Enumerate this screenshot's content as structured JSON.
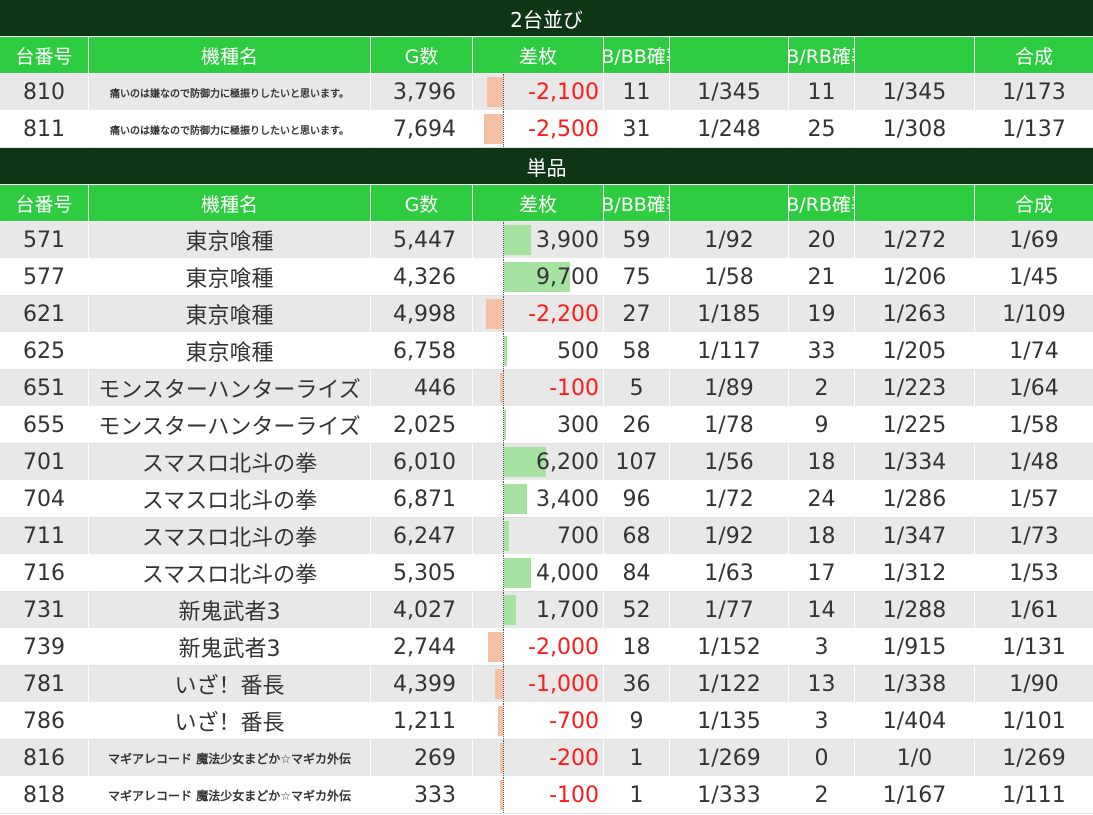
{
  "colors": {
    "header_bg": "#2ecc40",
    "section_bg": "#0e3614",
    "positive_bar": "#a6e3a0",
    "negative_bar": "#f4bfa2",
    "negative_text": "#ff1a1a"
  },
  "columns": [
    "台番号",
    "機種名",
    "G数",
    "差枚",
    "BB/BB確率",
    "",
    "RB/RB確率",
    "",
    "合成"
  ],
  "sections": [
    {
      "title": "2台並び",
      "rows": [
        {
          "no": "810",
          "name": "痛いのは嫌なので防御力に極振りしたいと思います。",
          "size": "small",
          "games": "3,796",
          "diff": "-2,100",
          "diff_value": -2100,
          "bb": "11",
          "bb_rate": "1/345",
          "rb": "11",
          "rb_rate": "1/345",
          "total": "1/173"
        },
        {
          "no": "811",
          "name": "痛いのは嫌なので防御力に極振りしたいと思います。",
          "size": "small",
          "games": "7,694",
          "diff": "-2,500",
          "diff_value": -2500,
          "bb": "31",
          "bb_rate": "1/248",
          "rb": "25",
          "rb_rate": "1/308",
          "total": "1/137"
        }
      ]
    },
    {
      "title": "単品",
      "rows": [
        {
          "no": "571",
          "name": "東京喰種",
          "size": "normal",
          "games": "5,447",
          "diff": "3,900",
          "diff_value": 3900,
          "bb": "59",
          "bb_rate": "1/92",
          "rb": "20",
          "rb_rate": "1/272",
          "total": "1/69"
        },
        {
          "no": "577",
          "name": "東京喰種",
          "size": "normal",
          "games": "4,326",
          "diff": "9,700",
          "diff_value": 9700,
          "bb": "75",
          "bb_rate": "1/58",
          "rb": "21",
          "rb_rate": "1/206",
          "total": "1/45"
        },
        {
          "no": "621",
          "name": "東京喰種",
          "size": "normal",
          "games": "4,998",
          "diff": "-2,200",
          "diff_value": -2200,
          "bb": "27",
          "bb_rate": "1/185",
          "rb": "19",
          "rb_rate": "1/263",
          "total": "1/109"
        },
        {
          "no": "625",
          "name": "東京喰種",
          "size": "normal",
          "games": "6,758",
          "diff": "500",
          "diff_value": 500,
          "bb": "58",
          "bb_rate": "1/117",
          "rb": "33",
          "rb_rate": "1/205",
          "total": "1/74"
        },
        {
          "no": "651",
          "name": "モンスターハンターライズ",
          "size": "normal",
          "games": "446",
          "diff": "-100",
          "diff_value": -100,
          "bb": "5",
          "bb_rate": "1/89",
          "rb": "2",
          "rb_rate": "1/223",
          "total": "1/64"
        },
        {
          "no": "655",
          "name": "モンスターハンターライズ",
          "size": "normal",
          "games": "2,025",
          "diff": "300",
          "diff_value": 300,
          "bb": "26",
          "bb_rate": "1/78",
          "rb": "9",
          "rb_rate": "1/225",
          "total": "1/58"
        },
        {
          "no": "701",
          "name": "スマスロ北斗の拳",
          "size": "normal",
          "games": "6,010",
          "diff": "6,200",
          "diff_value": 6200,
          "bb": "107",
          "bb_rate": "1/56",
          "rb": "18",
          "rb_rate": "1/334",
          "total": "1/48"
        },
        {
          "no": "704",
          "name": "スマスロ北斗の拳",
          "size": "normal",
          "games": "6,871",
          "diff": "3,400",
          "diff_value": 3400,
          "bb": "96",
          "bb_rate": "1/72",
          "rb": "24",
          "rb_rate": "1/286",
          "total": "1/57"
        },
        {
          "no": "711",
          "name": "スマスロ北斗の拳",
          "size": "normal",
          "games": "6,247",
          "diff": "700",
          "diff_value": 700,
          "bb": "68",
          "bb_rate": "1/92",
          "rb": "18",
          "rb_rate": "1/347",
          "total": "1/73"
        },
        {
          "no": "716",
          "name": "スマスロ北斗の拳",
          "size": "normal",
          "games": "5,305",
          "diff": "4,000",
          "diff_value": 4000,
          "bb": "84",
          "bb_rate": "1/63",
          "rb": "17",
          "rb_rate": "1/312",
          "total": "1/53"
        },
        {
          "no": "731",
          "name": "新鬼武者3",
          "size": "normal",
          "games": "4,027",
          "diff": "1,700",
          "diff_value": 1700,
          "bb": "52",
          "bb_rate": "1/77",
          "rb": "14",
          "rb_rate": "1/288",
          "total": "1/61"
        },
        {
          "no": "739",
          "name": "新鬼武者3",
          "size": "normal",
          "games": "2,744",
          "diff": "-2,000",
          "diff_value": -2000,
          "bb": "18",
          "bb_rate": "1/152",
          "rb": "3",
          "rb_rate": "1/915",
          "total": "1/131"
        },
        {
          "no": "781",
          "name": "いざ！番長",
          "size": "normal",
          "games": "4,399",
          "diff": "-1,000",
          "diff_value": -1000,
          "bb": "36",
          "bb_rate": "1/122",
          "rb": "13",
          "rb_rate": "1/338",
          "total": "1/90"
        },
        {
          "no": "786",
          "name": "いざ！番長",
          "size": "normal",
          "games": "1,211",
          "diff": "-700",
          "diff_value": -700,
          "bb": "9",
          "bb_rate": "1/135",
          "rb": "3",
          "rb_rate": "1/404",
          "total": "1/101"
        },
        {
          "no": "816",
          "name": "マギアレコード 魔法少女まどか☆マギカ外伝",
          "size": "mid",
          "games": "269",
          "diff": "-200",
          "diff_value": -200,
          "bb": "1",
          "bb_rate": "1/269",
          "rb": "0",
          "rb_rate": "1/0",
          "total": "1/269"
        },
        {
          "no": "818",
          "name": "マギアレコード 魔法少女まどか☆マギカ外伝",
          "size": "mid",
          "games": "333",
          "diff": "-100",
          "diff_value": -100,
          "bb": "1",
          "bb_rate": "1/333",
          "rb": "2",
          "rb_rate": "1/167",
          "total": "1/111"
        }
      ]
    }
  ]
}
